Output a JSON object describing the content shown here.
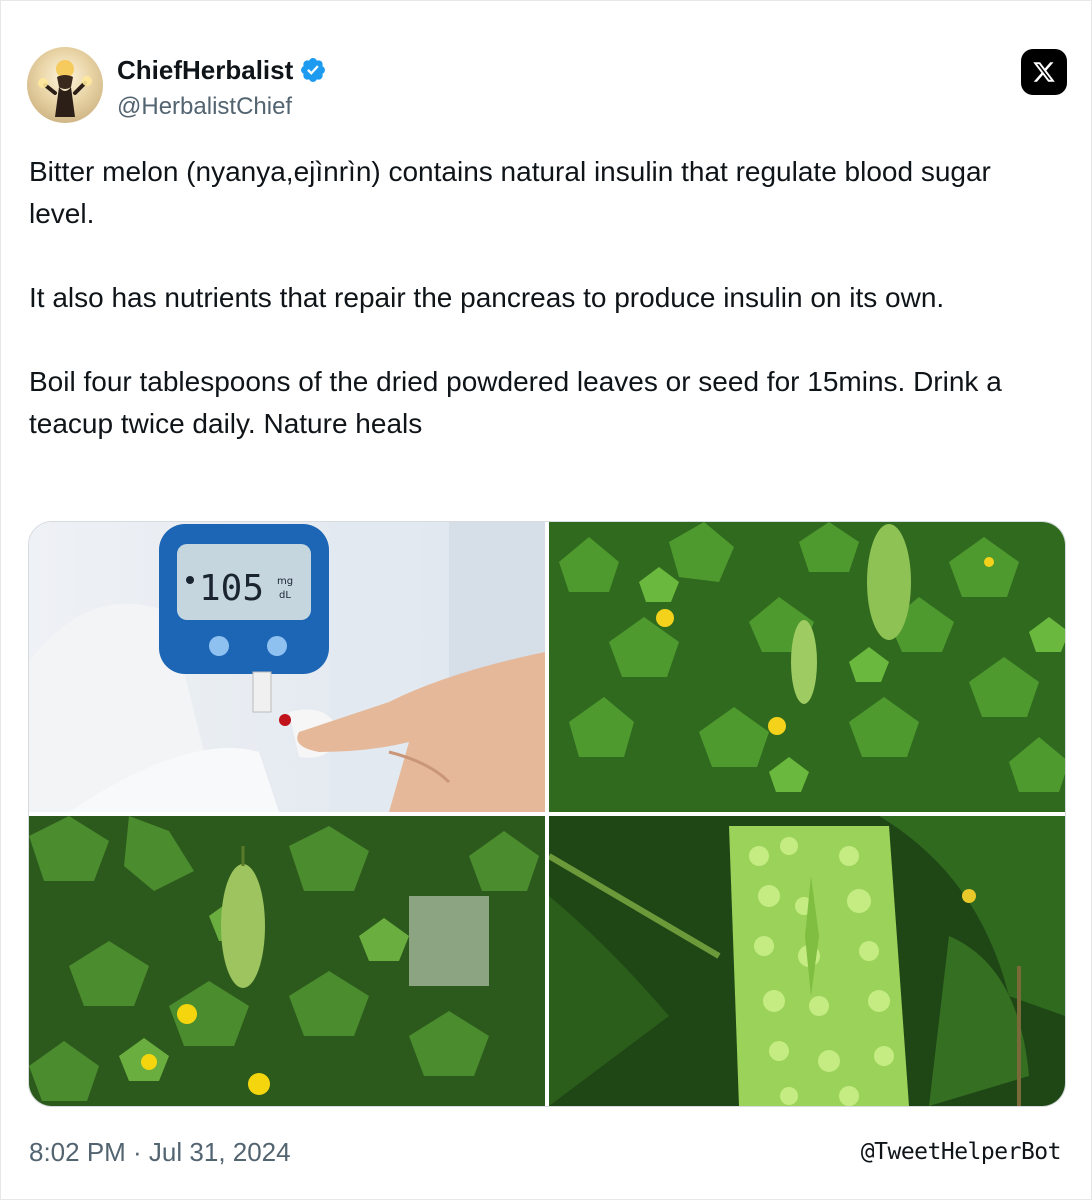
{
  "post": {
    "author": {
      "display_name": "ChiefHerbalist",
      "handle": "@HerbalistChief",
      "verified": true
    },
    "platform_icon": "x-logo-icon",
    "text": "Bitter melon (nyanya,ejìnrìn) contains natural insulin that regulate blood sugar level.\n\nIt also has nutrients that repair the pancreas to produce insulin on its own.\n\nBoil four tablespoons of the dried powdered leaves or seed for 15mins. Drink a teacup twice daily. Nature heals",
    "timestamp": "8:02 PM · Jul 31, 2024",
    "media": {
      "glucometer_reading": "105",
      "glucometer_unit_top": "mg",
      "glucometer_unit_bottom": "dL"
    }
  },
  "watermark": "@TweetHelperBot",
  "colors": {
    "verified_blue": "#1d9bf0",
    "secondary_text": "#536471",
    "primary_text": "#0f1419"
  }
}
